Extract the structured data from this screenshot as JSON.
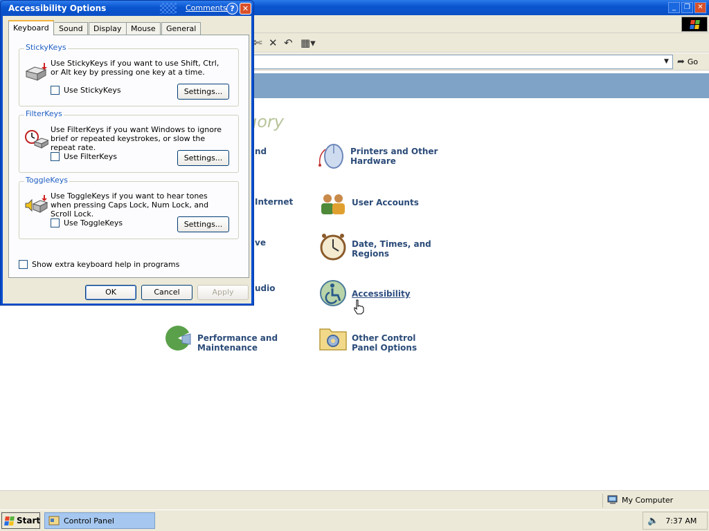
{
  "dialog": {
    "title": "Accessibility Options",
    "comments_link": "Comments?",
    "help_glyph": "?",
    "close_glyph": "✕",
    "tabs": [
      {
        "label": "Keyboard"
      },
      {
        "label": "Sound"
      },
      {
        "label": "Display"
      },
      {
        "label": "Mouse"
      },
      {
        "label": "General"
      }
    ],
    "active_tab": "Keyboard",
    "groups": [
      {
        "title": "StickyKeys",
        "description": "Use StickyKeys if you want to use Shift, Ctrl, or Alt key by pressing one key at a time.",
        "checkbox_label": "Use StickyKeys",
        "checked": false,
        "settings_label": "Settings..."
      },
      {
        "title": "FilterKeys",
        "description": "Use FilterKeys if you want Windows to ignore brief or repeated keystrokes, or slow the repeat rate.",
        "checkbox_label": "Use FilterKeys",
        "checked": false,
        "settings_label": "Settings..."
      },
      {
        "title": "ToggleKeys",
        "description": "Use ToggleKeys if you want to hear tones when pressing Caps Lock, Num Lock, and Scroll Lock.",
        "checkbox_label": "Use ToggleKeys",
        "checked": false,
        "settings_label": "Settings..."
      }
    ],
    "extra_help_label": "Show extra keyboard help in programs",
    "buttons": {
      "ok": "OK",
      "cancel": "Cancel",
      "apply": "Apply"
    }
  },
  "control_panel": {
    "toolbar_icons": [
      "move-to-icon",
      "delete-icon",
      "undo-icon",
      "views-icon"
    ],
    "go_label": "Go",
    "pick_category_partial": "gory",
    "partial_labels": [
      "nd",
      "Internet",
      "ve",
      "udio"
    ],
    "categories": [
      {
        "label": "Printers and Other Hardware",
        "icon": "printer-mouse-icon"
      },
      {
        "label": "User Accounts",
        "icon": "user-accounts-icon"
      },
      {
        "label": "Date, Times, and Regions",
        "icon": "clock-icon"
      },
      {
        "label": "Accessibility",
        "icon": "accessibility-icon",
        "hover": true
      },
      {
        "label": "Performance and Maintenance",
        "icon": "performance-icon"
      },
      {
        "label": "Other Control Panel Options",
        "icon": "other-options-icon"
      }
    ]
  },
  "status_bar": {
    "location": "My Computer"
  },
  "taskbar": {
    "start_label": "Start",
    "task_label": "Control Panel",
    "clock": "7:37 AM"
  },
  "colors": {
    "titlebar_blue": "#0a55cf",
    "category_text": "#2b4b78",
    "group_title": "#1f5fc1",
    "header_band": "#7fa3c6"
  }
}
